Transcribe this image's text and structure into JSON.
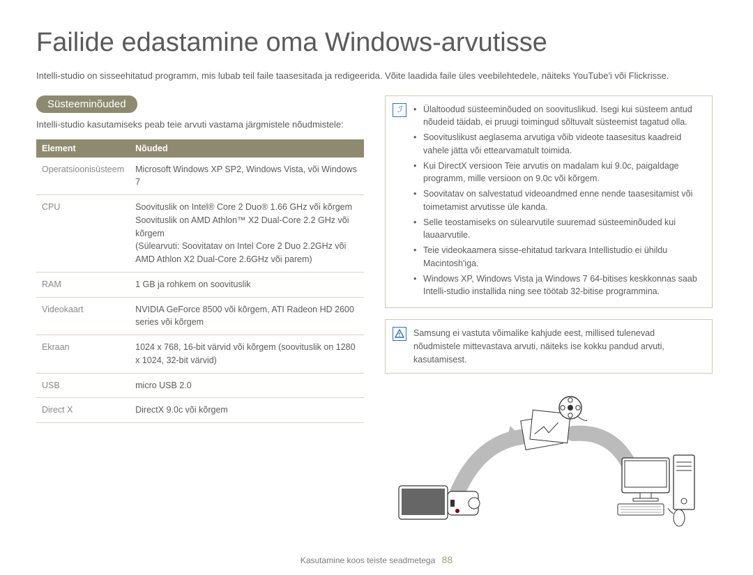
{
  "title": "Failide edastamine oma Windows-arvutisse",
  "intro": "Intelli-studio on sisseehitatud programm, mis lubab teil faile taasesitada ja redigeerida. Võite laadida faile üles veebilehtedele, näiteks YouTube'i või Flickrisse.",
  "left": {
    "header": "Süsteeminõuded",
    "subtext": "Intelli-studio kasutamiseks peab teie arvuti vastama järgmistele nõudmistele:",
    "table": {
      "col0": "Element",
      "col1": "Nõuded",
      "rows": [
        {
          "k": "Operatsioonisüsteem",
          "v": "Microsoft Windows XP SP2, Windows Vista, või Windows 7"
        },
        {
          "k": "CPU",
          "v": "Soovituslik on Intel® Core 2 Duo® 1.66 GHz või kõrgem Soovituslik on AMD Athlon™ X2 Dual-Core 2.2 GHz või kõrgem\n(Sülearvuti: Soovitatav on Intel Core 2 Duo 2.2GHz või AMD Athlon X2 Dual-Core 2.6GHz või parem)"
        },
        {
          "k": "RAM",
          "v": "1 GB ja rohkem on soovituslik"
        },
        {
          "k": "Videokaart",
          "v": "NVIDIA GeForce 8500 või kõrgem, ATI Radeon HD 2600 series või kõrgem"
        },
        {
          "k": "Ekraan",
          "v": "1024 x 768, 16-bit värvid või kõrgem (soovituslik on 1280 x 1024, 32-bit värvid)"
        },
        {
          "k": "USB",
          "v": "micro USB 2.0"
        },
        {
          "k": "Direct X",
          "v": "DirectX 9.0c või kõrgem"
        }
      ]
    }
  },
  "right": {
    "note1": {
      "items": [
        "Ülaltoodud süsteeminõuded on soovituslikud. Isegi kui süsteem antud nõudeid täidab, ei pruugi toimingud sõltuvalt süsteemist tagatud olla.",
        "Soovituslikust aeglasema arvutiga võib videote taasesitus kaadreid vahele jätta või ettearvamatult toimida.",
        "Kui DirectX versioon Teie arvutis on madalam kui 9.0c, paigaldage programm, mille versioon on 9.0c või kõrgem.",
        "Soovitatav on salvestatud videoandmed enne nende taasesitamist või toimetamist arvutisse üle kanda.",
        "Selle teostamiseks on sülearvutile suuremad süsteeminõuded kui lauaarvutile.",
        "Teie videokaamera sisse-ehitatud tarkvara Intellistudio ei ühildu Macintosh'iga.",
        "Windows XP, Windows Vista ja Windows 7 64-bitises keskkonnas saab Intelli-studio installida ning see töötab 32-bitise programmina."
      ]
    },
    "note2": {
      "text": "Samsung ei vastuta võimalike kahjude eest, millised tulenevad nõudmistele mittevastava arvuti, näiteks ise kokku pandud arvuti, kasutamisest."
    }
  },
  "footer": {
    "section": "Kasutamine koos teiste seadmetega",
    "page": "88"
  },
  "illustration_items": {
    "camcorder": "camcorder",
    "photos": "photos-stack",
    "film_reel": "film-reel",
    "computer": "desktop-computer",
    "arrow1": "arrow",
    "arrow2": "arrow"
  }
}
